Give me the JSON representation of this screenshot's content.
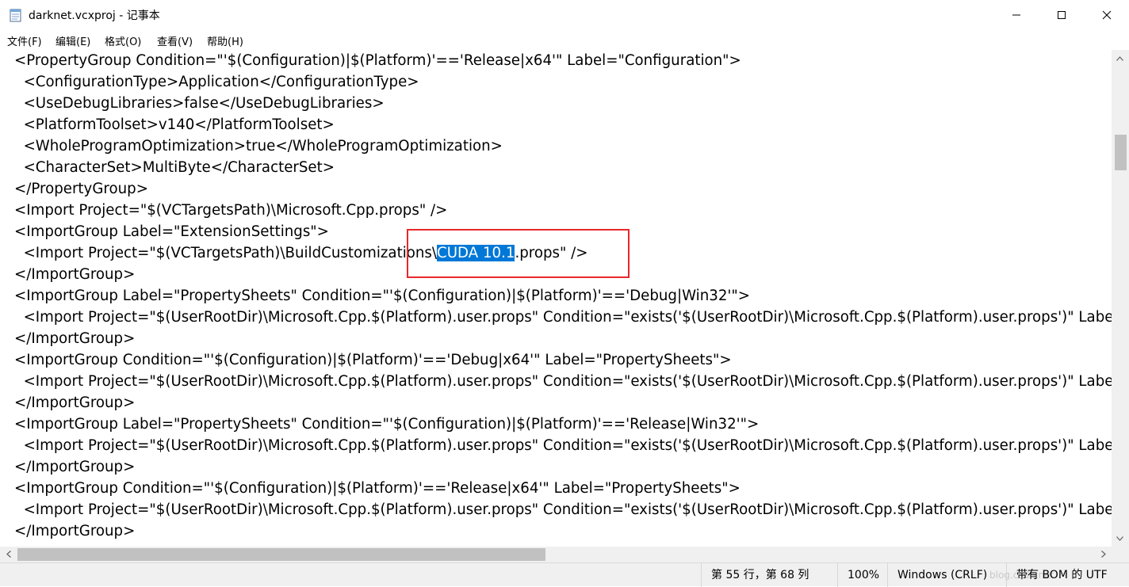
{
  "window": {
    "title": "darknet.vcxproj - 记事本",
    "minimize_icon": "minimize-icon",
    "maximize_icon": "maximize-icon",
    "close_icon": "close-icon"
  },
  "menu": {
    "file": "文件(F)",
    "edit": "编辑(E)",
    "format": "格式(O)",
    "view": "查看(V)",
    "help": "帮助(H)"
  },
  "editor": {
    "lines": [
      "<PropertyGroup Condition=\"'$(Configuration)|$(Platform)'=='Release|x64'\" Label=\"Configuration\">",
      "  <ConfigurationType>Application</ConfigurationType>",
      "  <UseDebugLibraries>false</UseDebugLibraries>",
      "  <PlatformToolset>v140</PlatformToolset>",
      "  <WholeProgramOptimization>true</WholeProgramOptimization>",
      "  <CharacterSet>MultiByte</CharacterSet>",
      "</PropertyGroup>",
      "<Import Project=\"$(VCTargetsPath)\\Microsoft.Cpp.props\" />",
      "<ImportGroup Label=\"ExtensionSettings\">",
      "",
      "</ImportGroup>",
      "<ImportGroup Label=\"PropertySheets\" Condition=\"'$(Configuration)|$(Platform)'=='Debug|Win32'\">",
      "  <Import Project=\"$(UserRootDir)\\Microsoft.Cpp.$(Platform).user.props\" Condition=\"exists('$(UserRootDir)\\Microsoft.Cpp.$(Platform).user.props')\" Label=\"LocalAppDataPlatform\" />",
      "</ImportGroup>",
      "<ImportGroup Condition=\"'$(Configuration)|$(Platform)'=='Debug|x64'\" Label=\"PropertySheets\">",
      "  <Import Project=\"$(UserRootDir)\\Microsoft.Cpp.$(Platform).user.props\" Condition=\"exists('$(UserRootDir)\\Microsoft.Cpp.$(Platform).user.props')\" Label=\"LocalAppDataPlatform\" />",
      "</ImportGroup>",
      "<ImportGroup Label=\"PropertySheets\" Condition=\"'$(Configuration)|$(Platform)'=='Release|Win32'\">",
      "  <Import Project=\"$(UserRootDir)\\Microsoft.Cpp.$(Platform).user.props\" Condition=\"exists('$(UserRootDir)\\Microsoft.Cpp.$(Platform).user.props')\" Label=\"LocalAppDataPlatform\" />",
      "</ImportGroup>",
      "<ImportGroup Condition=\"'$(Configuration)|$(Platform)'=='Release|x64'\" Label=\"PropertySheets\">",
      "  <Import Project=\"$(UserRootDir)\\Microsoft.Cpp.$(Platform).user.props\" Condition=\"exists('$(UserRootDir)\\Microsoft.Cpp.$(Platform).user.props')\" Label=\"LocalAppDataPlatform\" />",
      "</ImportGroup>"
    ],
    "selection_line": {
      "before": "  <Import Project=\"$(VCTargetsPath)\\BuildCustomizations\\",
      "selected": "CUDA 10.1",
      "after": ".props\" />"
    }
  },
  "statusbar": {
    "position": "第 55 行，第 68 列",
    "zoom": "100%",
    "line_ending": "Windows (CRLF)",
    "encoding": "带有 BOM 的 UTF",
    "watermark": "blog.csdn.net"
  },
  "colors": {
    "selection": "#0078d7",
    "annotation_box": "#e8282b"
  }
}
